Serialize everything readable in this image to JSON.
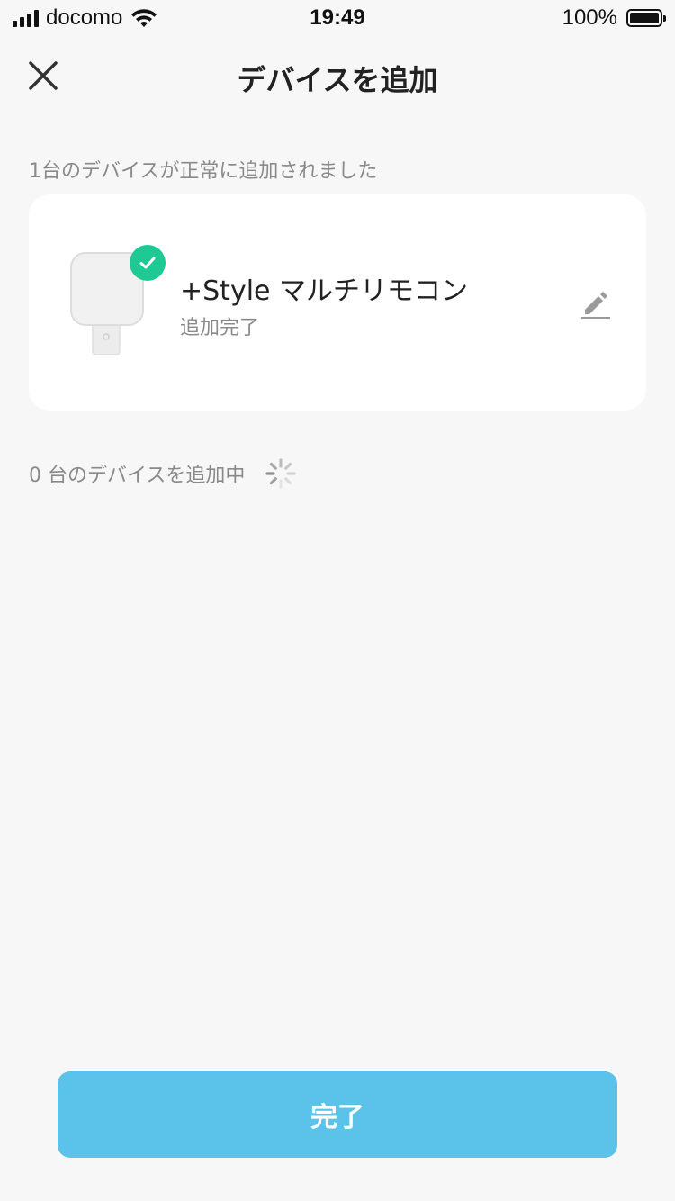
{
  "status_bar": {
    "carrier": "docomo",
    "time": "19:49",
    "battery": "100%"
  },
  "navbar": {
    "title": "デバイスを追加",
    "close_icon": "close-icon"
  },
  "success_section": {
    "label": "1台のデバイスが正常に追加されました",
    "device": {
      "name": "+Style マルチリモコン",
      "status": "追加完了",
      "badge_icon": "check-icon",
      "edit_icon": "pencil-icon"
    }
  },
  "adding_section": {
    "label": "0 台のデバイスを追加中",
    "spinner_icon": "spinner-icon"
  },
  "footer": {
    "done_label": "完了"
  },
  "colors": {
    "accent": "#5bc3ea",
    "success": "#1fc994",
    "background": "#f7f7f7"
  }
}
